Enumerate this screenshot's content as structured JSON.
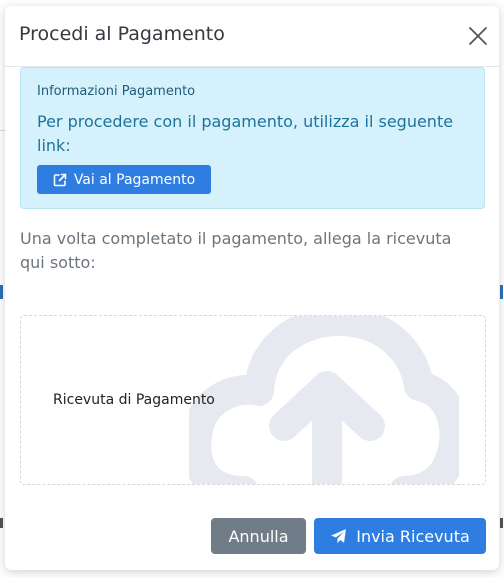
{
  "modal": {
    "title": "Procedi al Pagamento"
  },
  "info": {
    "title": "Informazioni Pagamento",
    "text": "Per procedere con il pagamento, utilizza il seguente link:",
    "button_label": "Vai al Pagamento"
  },
  "instructions": "Una volta completato il pagamento, allega la ricevuta qui sotto:",
  "upload": {
    "label": "Ricevuta di Pagamento",
    "icon": "cloud-upload-icon"
  },
  "footer": {
    "cancel_label": "Annulla",
    "submit_label": "Invia Ricevuta"
  },
  "colors": {
    "primary": "#2e7de1",
    "secondary": "#717c89",
    "info_bg": "#d5f1fb",
    "info_text": "#1e7399"
  }
}
